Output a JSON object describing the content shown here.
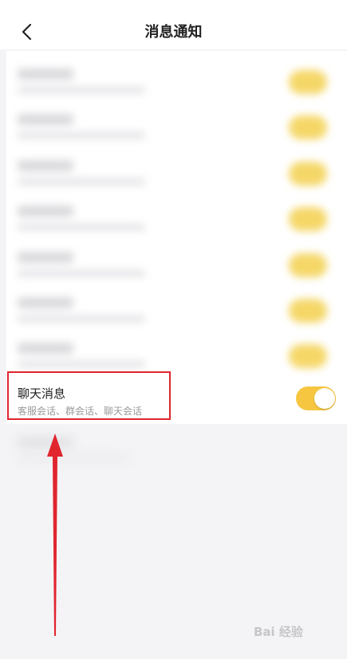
{
  "header": {
    "title": "消息通知"
  },
  "chat_message": {
    "title": "聊天消息",
    "subtitle": "客服会话、群会话、聊天会话",
    "toggle": {
      "enabled": true,
      "color": "#f6c641"
    }
  },
  "annotation": {
    "highlight_color": "#e0252e",
    "arrow_color": "#e0252e"
  },
  "watermark": {
    "text": "Bai 经验"
  }
}
